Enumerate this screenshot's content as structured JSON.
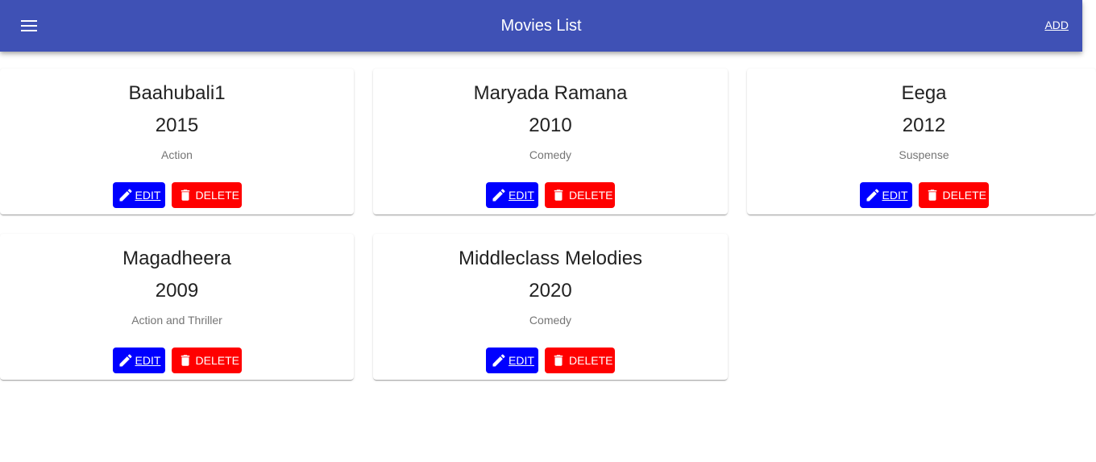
{
  "appbar": {
    "title": "Movies List",
    "add_label": "ADD",
    "menu_icon": "menu-icon",
    "color": "#3f51b5"
  },
  "buttons": {
    "edit_label": "EDIT",
    "delete_label": "DELETE",
    "edit_color": "#0000ff",
    "delete_color": "#ff0000"
  },
  "movies": [
    {
      "title": "Baahubali1",
      "year": "2015",
      "genre": "Action"
    },
    {
      "title": "Maryada Ramana",
      "year": "2010",
      "genre": "Comedy"
    },
    {
      "title": "Eega",
      "year": "2012",
      "genre": "Suspense"
    },
    {
      "title": "Magadheera",
      "year": "2009",
      "genre": "Action and Thriller"
    },
    {
      "title": "Middleclass Melodies",
      "year": "2020",
      "genre": "Comedy"
    }
  ]
}
